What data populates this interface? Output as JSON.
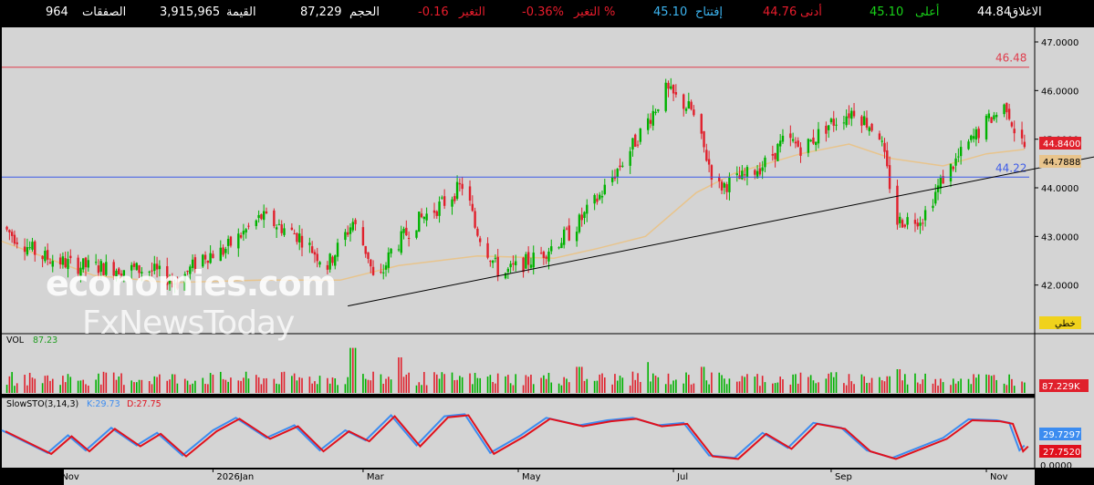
{
  "header": {
    "close": {
      "label": "الاغلاق",
      "value": "44.84"
    },
    "high": {
      "label": "أعلى",
      "value": "45.10"
    },
    "low": {
      "label": "أدنى",
      "value": "44.76"
    },
    "open": {
      "label": "إفتتاح",
      "value": "45.10"
    },
    "change_pct": {
      "label": "التغير %",
      "value": "-0.36%"
    },
    "change": {
      "label": "التغير",
      "value": "-0.16"
    },
    "volume": {
      "label": "الحجم",
      "value": "87,229"
    },
    "value": {
      "label": "القيمة",
      "value": "3,915,965"
    },
    "trades": {
      "label": "الصفقات",
      "value": "964"
    }
  },
  "colors": {
    "up": "#00b200",
    "down": "#e0202c",
    "panel_bg": "#d4d4d4",
    "ma": "#e8c48c",
    "resistance": "#e03c4c",
    "support": "#3c5ae8",
    "trendline": "#000000",
    "stoch_k": "#3c8cf0",
    "stoch_d": "#e0101c",
    "header_green": "#19d219",
    "header_red": "#e81c2c",
    "header_blue": "#3cb4f0"
  },
  "labels": {
    "vol_title": "VOL",
    "vol_value": "87.23",
    "stoch_title": "SlowSTO(3,14,3)",
    "stoch_k": "K:29.73",
    "stoch_d": "D:27.75",
    "tag_price": "44.8400",
    "tag_ma": "44.7888",
    "tag_line_type": "خطي",
    "tag_vol": "87.229K",
    "tag_k": "29.7297",
    "tag_d": "27.7520",
    "stoch_zero": "0.0000"
  },
  "watermark": {
    "line1": "economies.com",
    "line2": "FxNewsToday"
  },
  "chart_data": {
    "type": "candlestick",
    "x_range": [
      "2025-10-10",
      "2026-11-20"
    ],
    "y_range": [
      41.0,
      47.3
    ],
    "y_ticks": [
      42.0,
      43.0,
      44.0,
      45.0,
      46.0,
      47.0
    ],
    "y_tick_labels": [
      "42.0000",
      "43.0000",
      "44.0000",
      "45.0000",
      "46.0000",
      "47.0000"
    ],
    "x_ticks": [
      {
        "date": "2025-11-01",
        "label": "Nov"
      },
      {
        "date": "2026-01-01",
        "label": "2026Jan"
      },
      {
        "date": "2026-03-01",
        "label": "Mar"
      },
      {
        "date": "2026-05-01",
        "label": "May"
      },
      {
        "date": "2026-07-01",
        "label": "Jul"
      },
      {
        "date": "2026-09-01",
        "label": "Sep"
      },
      {
        "date": "2026-11-01",
        "label": "Nov"
      }
    ],
    "close_path": [
      [
        "2025-10-10",
        43.2
      ],
      [
        "2025-10-25",
        42.6
      ],
      [
        "2025-11-08",
        42.4
      ],
      [
        "2025-11-23",
        42.35
      ],
      [
        "2025-12-08",
        42.3
      ],
      [
        "2025-12-18",
        42.05
      ],
      [
        "2025-12-28",
        42.6
      ],
      [
        "2026-01-05",
        42.7
      ],
      [
        "2026-01-20",
        43.4
      ],
      [
        "2026-02-04",
        43.0
      ],
      [
        "2026-02-15",
        42.4
      ],
      [
        "2026-02-25",
        43.3
      ],
      [
        "2026-03-03",
        42.6
      ],
      [
        "2026-03-06",
        41.9
      ],
      [
        "2026-03-12",
        42.7
      ],
      [
        "2026-03-22",
        43.3
      ],
      [
        "2026-04-02",
        43.7
      ],
      [
        "2026-04-10",
        44.1
      ],
      [
        "2026-04-14",
        43.2
      ],
      [
        "2026-04-24",
        42.2
      ],
      [
        "2026-05-09",
        42.6
      ],
      [
        "2026-05-22",
        43.1
      ],
      [
        "2026-06-03",
        43.9
      ],
      [
        "2026-06-13",
        44.7
      ],
      [
        "2026-06-20",
        45.3
      ],
      [
        "2026-06-28",
        46.0
      ],
      [
        "2026-07-08",
        45.6
      ],
      [
        "2026-07-18",
        44.0
      ],
      [
        "2026-07-28",
        44.2
      ],
      [
        "2026-08-06",
        44.5
      ],
      [
        "2026-08-14",
        45.0
      ],
      [
        "2026-08-21",
        44.8
      ],
      [
        "2026-08-31",
        45.3
      ],
      [
        "2026-09-10",
        45.6
      ],
      [
        "2026-09-20",
        45.1
      ],
      [
        "2026-09-27",
        43.3
      ],
      [
        "2026-10-07",
        43.4
      ],
      [
        "2026-10-15",
        44.2
      ],
      [
        "2026-10-25",
        44.9
      ],
      [
        "2026-11-02",
        45.4
      ],
      [
        "2026-11-09",
        45.7
      ],
      [
        "2026-11-12",
        45.2
      ],
      [
        "2026-11-16",
        44.84
      ]
    ],
    "moving_average": [
      [
        "2025-10-10",
        42.9
      ],
      [
        "2025-11-15",
        42.2
      ],
      [
        "2025-12-15",
        42.05
      ],
      [
        "2026-01-20",
        42.1
      ],
      [
        "2026-02-20",
        42.1
      ],
      [
        "2026-03-15",
        42.4
      ],
      [
        "2026-04-15",
        42.6
      ],
      [
        "2026-05-15",
        42.55
      ],
      [
        "2026-06-01",
        42.75
      ],
      [
        "2026-06-20",
        43.0
      ],
      [
        "2026-07-10",
        43.9
      ],
      [
        "2026-07-25",
        44.3
      ],
      [
        "2026-08-20",
        44.7
      ],
      [
        "2026-09-08",
        44.9
      ],
      [
        "2026-09-25",
        44.6
      ],
      [
        "2026-10-15",
        44.45
      ],
      [
        "2026-11-01",
        44.7
      ],
      [
        "2026-11-16",
        44.79
      ]
    ],
    "resistance_level": 46.48,
    "resistance_label": "46.48",
    "support_level": 44.22,
    "support_label": "44.22",
    "trendline": {
      "from": [
        "2026-02-23",
        41.57
      ],
      "to": [
        "2026-12-31",
        44.82
      ]
    },
    "last_price": 44.84,
    "last_ma": 44.7888,
    "volume": {
      "last": 87229,
      "unit": "shares",
      "spikes": [
        [
          "2026-02-25",
          0.95
        ],
        [
          "2026-03-15",
          0.75
        ],
        [
          "2026-05-25",
          0.55
        ],
        [
          "2026-06-20",
          0.65
        ],
        [
          "2026-07-12",
          0.55
        ],
        [
          "2026-09-27",
          0.5
        ]
      ]
    },
    "stochastic": {
      "k_last": 29.73,
      "d_last": 27.75,
      "k_path": [
        [
          "2025-10-10",
          60
        ],
        [
          "2025-10-20",
          35
        ],
        [
          "2025-10-28",
          15
        ],
        [
          "2025-11-05",
          50
        ],
        [
          "2025-11-12",
          20
        ],
        [
          "2025-11-22",
          65
        ],
        [
          "2025-12-02",
          30
        ],
        [
          "2025-12-10",
          55
        ],
        [
          "2025-12-20",
          10
        ],
        [
          "2026-01-01",
          60
        ],
        [
          "2026-01-10",
          85
        ],
        [
          "2026-01-22",
          45
        ],
        [
          "2026-02-02",
          70
        ],
        [
          "2026-02-12",
          20
        ],
        [
          "2026-02-22",
          60
        ],
        [
          "2026-03-02",
          40
        ],
        [
          "2026-03-12",
          90
        ],
        [
          "2026-03-22",
          30
        ],
        [
          "2026-04-02",
          88
        ],
        [
          "2026-04-10",
          92
        ],
        [
          "2026-04-20",
          15
        ],
        [
          "2026-05-02",
          50
        ],
        [
          "2026-05-12",
          85
        ],
        [
          "2026-05-25",
          70
        ],
        [
          "2026-06-05",
          80
        ],
        [
          "2026-06-15",
          85
        ],
        [
          "2026-06-25",
          70
        ],
        [
          "2026-07-05",
          75
        ],
        [
          "2026-07-15",
          10
        ],
        [
          "2026-07-25",
          5
        ],
        [
          "2026-08-05",
          55
        ],
        [
          "2026-08-15",
          25
        ],
        [
          "2026-08-25",
          75
        ],
        [
          "2026-09-05",
          65
        ],
        [
          "2026-09-15",
          20
        ],
        [
          "2026-09-25",
          5
        ],
        [
          "2026-10-05",
          25
        ],
        [
          "2026-10-15",
          45
        ],
        [
          "2026-10-25",
          82
        ],
        [
          "2026-11-05",
          80
        ],
        [
          "2026-11-10",
          75
        ],
        [
          "2026-11-14",
          20
        ],
        [
          "2026-11-16",
          29.73
        ]
      ]
    }
  }
}
